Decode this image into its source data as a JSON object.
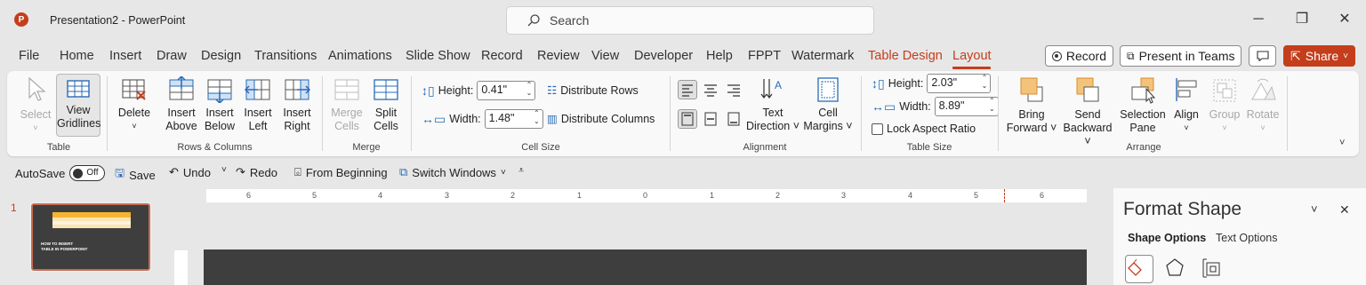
{
  "window": {
    "title": "Presentation2  -  PowerPoint",
    "app_icon_letter": "P",
    "search_placeholder": "Search",
    "controls": {
      "minimize": "─",
      "restore": "❐",
      "close": "✕"
    }
  },
  "menu": {
    "tabs": [
      "File",
      "Home",
      "Insert",
      "Draw",
      "Design",
      "Transitions",
      "Animations",
      "Slide Show",
      "Record",
      "Review",
      "View",
      "Developer",
      "Help",
      "FPPT",
      "Watermark"
    ],
    "tool_tab": "Table Design",
    "active_tab": "Layout",
    "record_label": "Record",
    "present_teams_label": "Present in Teams",
    "share_label": "Share"
  },
  "ribbon": {
    "table": {
      "group_label": "Table",
      "select_label": "Select",
      "view_gridlines_line1": "View",
      "view_gridlines_line2": "Gridlines"
    },
    "rows_columns": {
      "group_label": "Rows & Columns",
      "delete_label": "Delete",
      "insert_above": [
        "Insert",
        "Above"
      ],
      "insert_below": [
        "Insert",
        "Below"
      ],
      "insert_left": [
        "Insert",
        "Left"
      ],
      "insert_right": [
        "Insert",
        "Right"
      ]
    },
    "merge": {
      "group_label": "Merge",
      "merge_cells": [
        "Merge",
        "Cells"
      ],
      "split_cells": [
        "Split",
        "Cells"
      ]
    },
    "cell_size": {
      "group_label": "Cell Size",
      "height_label": "Height:",
      "height_value": "0.41\"",
      "width_label": "Width:",
      "width_value": "1.48\"",
      "distribute_rows": "Distribute Rows",
      "distribute_columns": "Distribute Columns"
    },
    "alignment": {
      "group_label": "Alignment",
      "text_direction": [
        "Text",
        "Direction ˅"
      ],
      "cell_margins": [
        "Cell",
        "Margins ˅"
      ]
    },
    "table_size": {
      "group_label": "Table Size",
      "height_label": "Height:",
      "height_value": "2.03\"",
      "width_label": "Width:",
      "width_value": "8.89\"",
      "lock_aspect": "Lock Aspect Ratio"
    },
    "arrange": {
      "group_label": "Arrange",
      "bring_forward": [
        "Bring",
        "Forward ˅"
      ],
      "send_backward": [
        "Send",
        "Backward ˅"
      ],
      "selection_pane": [
        "Selection",
        "Pane"
      ],
      "align": "Align",
      "group": "Group",
      "rotate": "Rotate"
    }
  },
  "qat": {
    "autosave_label": "AutoSave",
    "autosave_state": "Off",
    "save_label": "Save",
    "undo_label": "Undo",
    "redo_label": "Redo",
    "from_beginning_label": "From Beginning",
    "switch_windows_label": "Switch Windows"
  },
  "slides": {
    "number": "1",
    "thumb_text_line1": "HOW TO INSERT",
    "thumb_text_line2": "TABLE IN POWERPOINT"
  },
  "ruler": {
    "labels": [
      "6",
      "5",
      "4",
      "3",
      "2",
      "1",
      "0",
      "1",
      "2",
      "3",
      "4",
      "5",
      "6"
    ]
  },
  "format_pane": {
    "title": "Format Shape",
    "tab_shape": "Shape Options",
    "tab_text": "Text Options"
  },
  "colors": {
    "accent": "#c43e1c",
    "ribbon_bg": "#f9f9f9",
    "window_bg": "#e7e7e7",
    "slide_bg": "#3e3e3e"
  }
}
